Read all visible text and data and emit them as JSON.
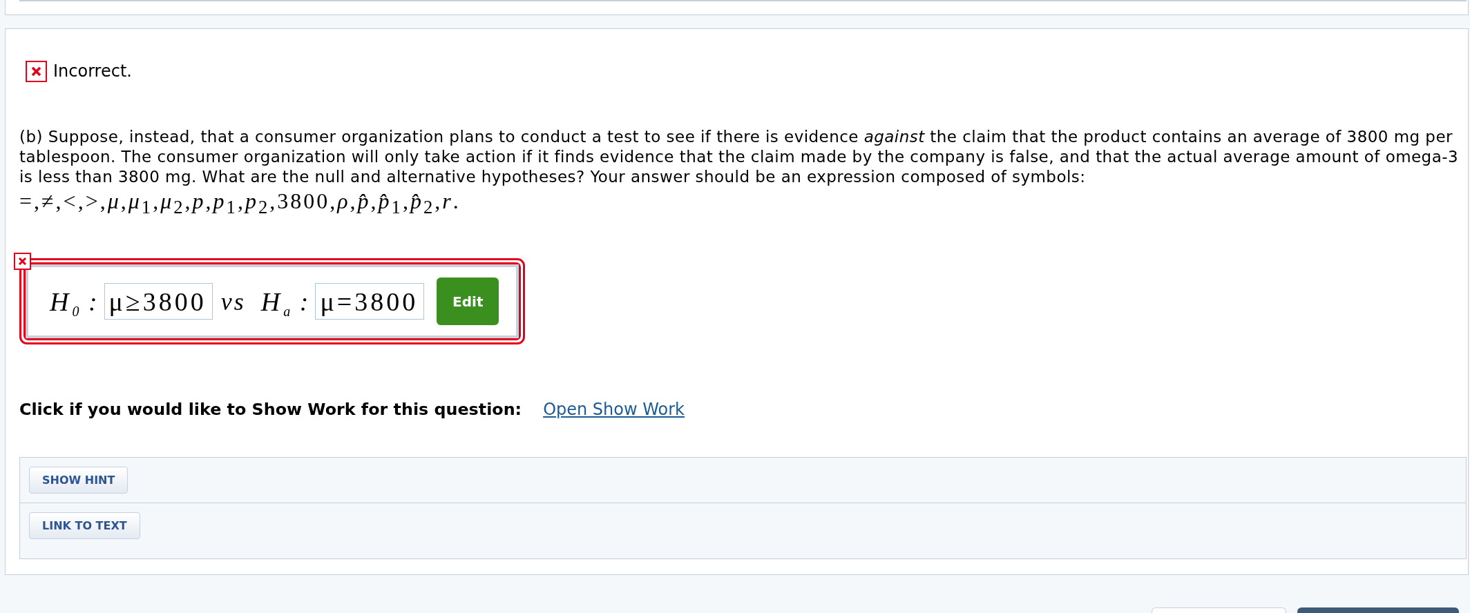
{
  "feedback": {
    "correct": false,
    "text": "Incorrect."
  },
  "question": {
    "text": "(b) Suppose, instead, that a consumer organization plans to conduct a test to see if there is evidence *against* the claim that the product contains an average of 3800 mg per tablespoon. The consumer organization will only take action if it finds evidence that the claim made by the company is false, and that the actual average amount of omega-3 is less than 3800 mg. What are the null and alternative hypotheses? Your answer should be an expression composed of symbols:",
    "symbols": "=,≠,<,>,*μ*,*μ*$_{1}$,*μ*$_{2}$,*p*,*p*$_{1}$,*p*$_{2}$,3800,*ρ*,*p̂*,*p̂*$_{1}$,*p̂*$_{2}$,*r*."
  },
  "answer": {
    "correct": false,
    "hypotheses": [
      {
        "label": "H$_{0}$ :",
        "value": "μ≥3800"
      },
      {
        "label": "H$_{a}$ :",
        "value": "μ=3800"
      }
    ],
    "connector": "vs",
    "button": "Edit"
  },
  "show_work": {
    "prompt": "Click if you would like to Show Work for this question:",
    "link": "Open Show Work"
  },
  "tools": [
    {
      "label": "SHOW HINT"
    },
    {
      "label": "LINK TO TEXT"
    }
  ],
  "footer_buttons": [
    {
      "kind": "secondary"
    },
    {
      "kind": "primary"
    }
  ]
}
